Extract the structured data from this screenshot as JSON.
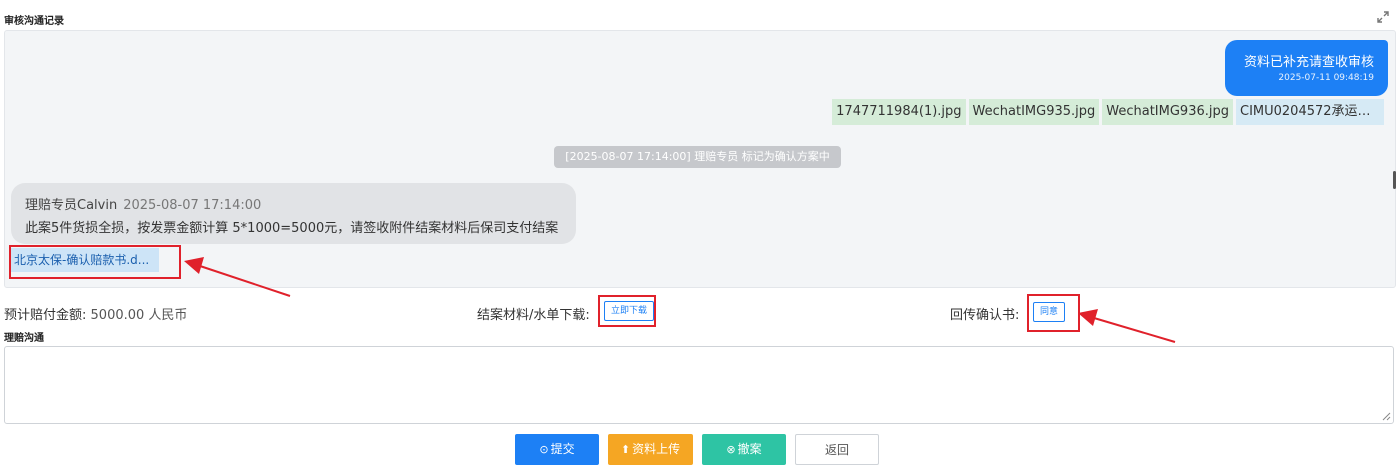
{
  "section_title": "审核沟通记录",
  "chat": {
    "outgoing": {
      "message": "资料已补充请查收审核",
      "time": "2025-07-11 09:48:19"
    },
    "files": [
      {
        "name": "1747711984(1).jpg",
        "kind": "green"
      },
      {
        "name": "WechatIMG935.jpg",
        "kind": "green"
      },
      {
        "name": "WechatIMG936.jpg",
        "kind": "green"
      },
      {
        "name": "CIMU0204572承运人...",
        "kind": "blue"
      }
    ],
    "system_note": "[2025-08-07 17:14:00] 理赔专员 标记为确认方案中",
    "incoming": {
      "sender": "理赔专员Calvin",
      "time": "2025-08-07 17:14:00",
      "content": "此案5件货损全损，按发票金额计算 5*1000=5000元，请签收附件结案材料后保司支付结案",
      "attachment": "北京太保-确认赔款书.d..."
    }
  },
  "info": {
    "pay_label": "预计赔付金额:",
    "pay_value": "5000.00 人民币",
    "download_label": "结案材料/水单下载:",
    "download_button": "立即下载",
    "confirm_label": "回传确认书:",
    "agree_button": "同意"
  },
  "communication": {
    "title": "理赔沟通",
    "placeholder": ""
  },
  "actions": {
    "submit": "提交",
    "upload": "资料上传",
    "withdraw": "撤案",
    "back": "返回"
  },
  "colors": {
    "primary": "#1d80f5",
    "upload": "#f5a623",
    "withdraw": "#2ec4a4",
    "highlight": "#e0212b"
  },
  "icons": {
    "expand": "expand-icon",
    "submit": "check-circle-icon",
    "upload": "upload-icon",
    "withdraw": "close-circle-icon",
    "resize": "resize-handle-icon"
  }
}
